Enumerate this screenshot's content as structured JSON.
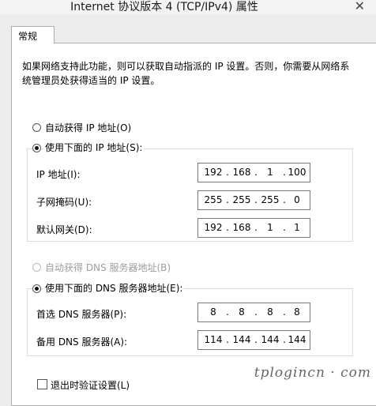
{
  "window": {
    "title": "Internet 协议版本 4 (TCP/IPv4) 属性",
    "close_glyph": "✕"
  },
  "tabs": [
    {
      "label": "常规",
      "selected": true
    }
  ],
  "description": "如果网络支持此功能，则可以获取自动指派的 IP 设置。否则，你需要从网络系统管理员处获得适当的 IP 设置。",
  "ip_section": {
    "auto_label": "自动获得 IP 地址(O)",
    "manual_label": "使用下面的 IP 地址(S):",
    "selected": "manual",
    "fields": [
      {
        "label": "IP 地址(I):",
        "octets": [
          "192",
          "168",
          "1",
          "100"
        ]
      },
      {
        "label": "子网掩码(U):",
        "octets": [
          "255",
          "255",
          "255",
          "0"
        ]
      },
      {
        "label": "默认网关(D):",
        "octets": [
          "192",
          "168",
          "1",
          "1"
        ]
      }
    ]
  },
  "dns_section": {
    "auto_label": "自动获得 DNS 服务器地址(B)",
    "manual_label": "使用下面的 DNS 服务器地址(E):",
    "selected": "manual",
    "fields": [
      {
        "label": "首选 DNS 服务器(P):",
        "octets": [
          "8",
          "8",
          "8",
          "8"
        ]
      },
      {
        "label": "备用 DNS 服务器(A):",
        "octets": [
          "114",
          "144",
          "144",
          "144"
        ]
      }
    ]
  },
  "validate_on_exit": {
    "label": "退出时验证设置(L)",
    "checked": false
  },
  "watermark": "tplogincn · com"
}
